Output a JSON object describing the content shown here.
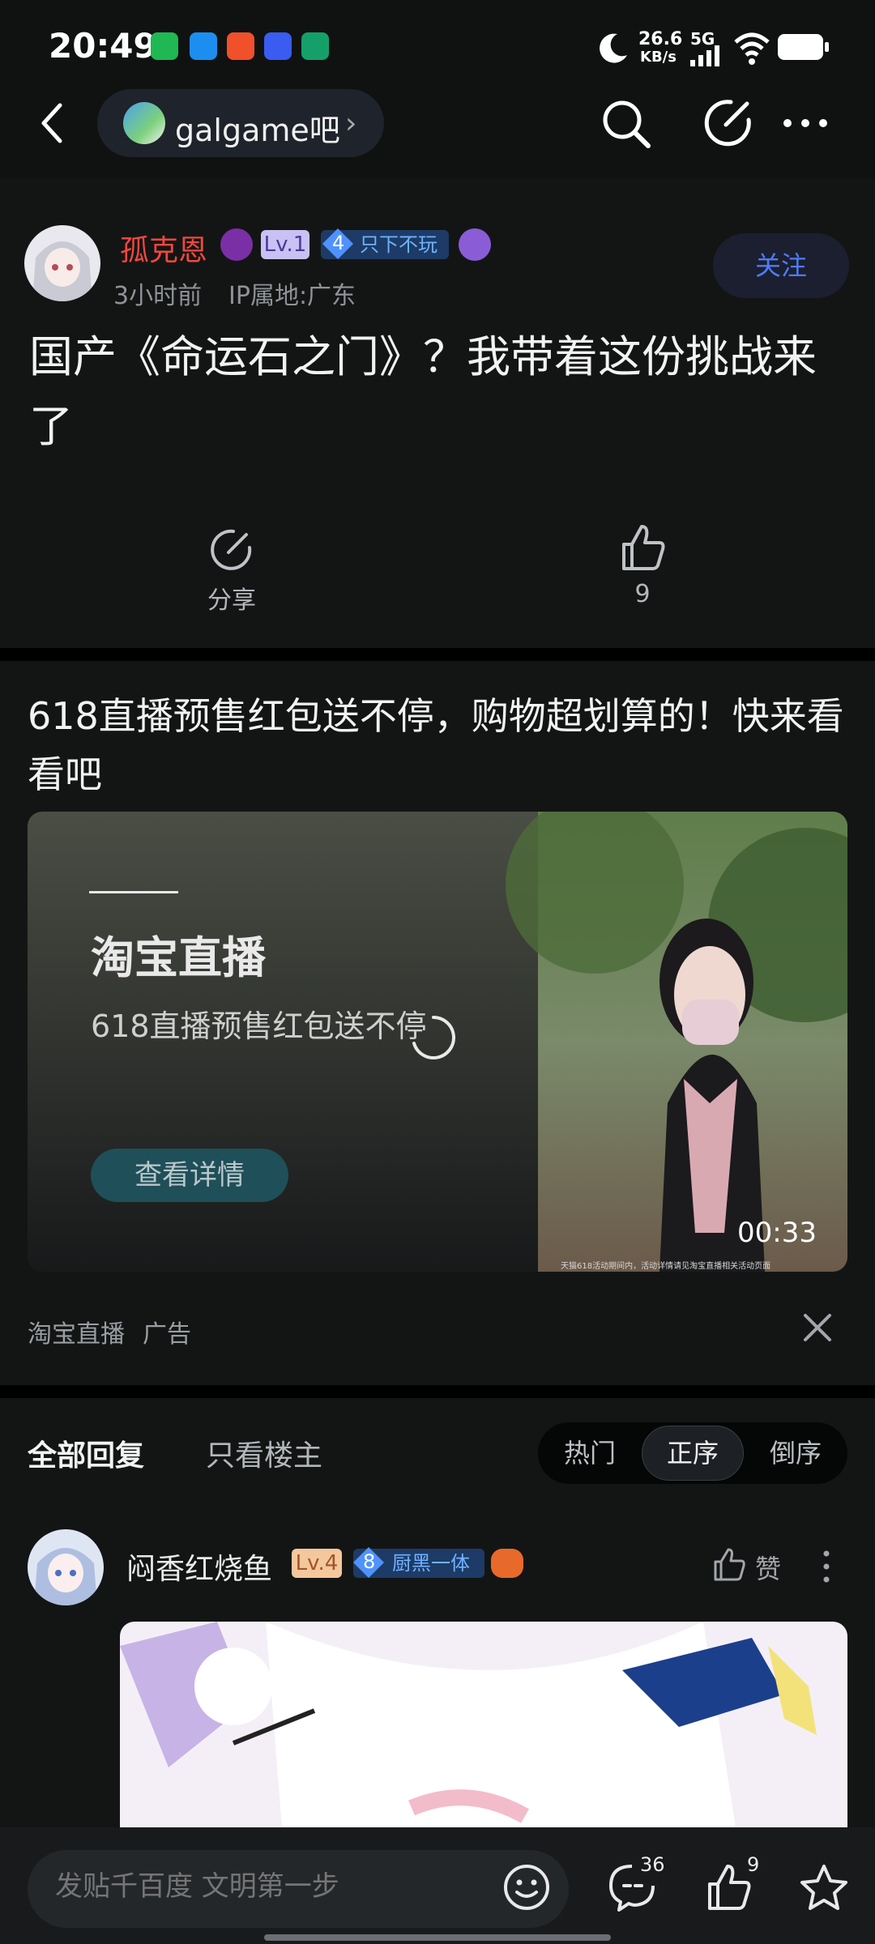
{
  "status_bar": {
    "time": "20:49",
    "net_speed_value": "26.6",
    "net_speed_unit": "KB/s",
    "network": "5G",
    "app_icons": [
      "wechat-icon",
      "eleme-icon",
      "sohu-icon",
      "vivo-icon",
      "bank-icon"
    ]
  },
  "nav": {
    "forum_name": "galgame吧",
    "forum_chevron": "›"
  },
  "post": {
    "author": "孤克恩",
    "level": "Lv.1",
    "title_badge_num": "4",
    "title_badge_text": "只下不玩",
    "time": "3小时前",
    "ip": "IP属地:广东",
    "follow": "关注",
    "title": "国产《命运石之门》？我带着这份挑战来了",
    "share_label": "分享",
    "like_count": "9"
  },
  "ad": {
    "title": "618直播预售红包送不停，购物超划算的！快来看看吧",
    "brand": "淘宝直播",
    "subtitle": "618直播预售红包送不停",
    "cta": "查看详情",
    "duration": "00:33",
    "fine_print": "天猫618活动期间内，活动详情请见淘宝直播相关活动页面",
    "source": "淘宝直播",
    "ad_label": "广告"
  },
  "replies": {
    "tab_all": "全部回复",
    "tab_op": "只看楼主",
    "sort": [
      "热门",
      "正序",
      "倒序"
    ],
    "active_sort": "正序",
    "first": {
      "author": "闷香红烧鱼",
      "level": "Lv.4",
      "badge_num": "8",
      "badge_text": "厨黑一体",
      "like_label": "赞"
    }
  },
  "bottom": {
    "placeholder": "发贴千百度 文明第一步",
    "comment_count": "36",
    "like_count": "9"
  },
  "colors": {
    "background": "#101212",
    "accent_blue": "#4d7cf6",
    "author_red": "#f0483e"
  }
}
